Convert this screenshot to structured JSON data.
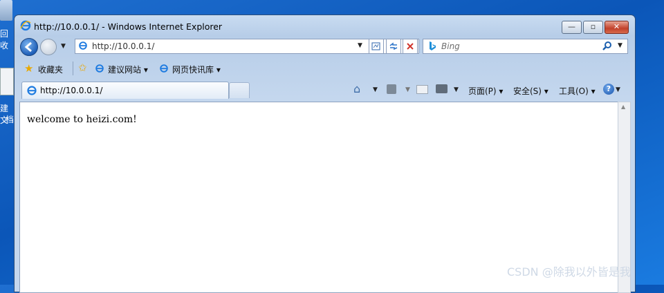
{
  "desktop": {
    "icon_label_1": "回收",
    "icon_label_2": "建文",
    "icon_label_3": "档"
  },
  "window": {
    "title": "http://10.0.0.1/ - Windows Internet Explorer",
    "buttons": {
      "minimize": "—",
      "maximize": "▫",
      "close": "✕"
    }
  },
  "nav": {
    "address": "http://10.0.0.1/",
    "search_placeholder": "Bing"
  },
  "favorites": {
    "label": "收藏夹",
    "items": [
      "建议网站 ▾",
      "网页快讯库 ▾"
    ]
  },
  "tab": {
    "title": "http://10.0.0.1/"
  },
  "commandbar": {
    "page": "页面(P) ▾",
    "safety": "安全(S) ▾",
    "tools": "工具(O) ▾"
  },
  "page": {
    "text": "welcome to heizi.com!"
  },
  "watermark": "CSDN @除我以外皆是我",
  "colors": {
    "desktop": "#0b56b8",
    "chrome": "#c4d7ee",
    "close": "#c2412b"
  }
}
